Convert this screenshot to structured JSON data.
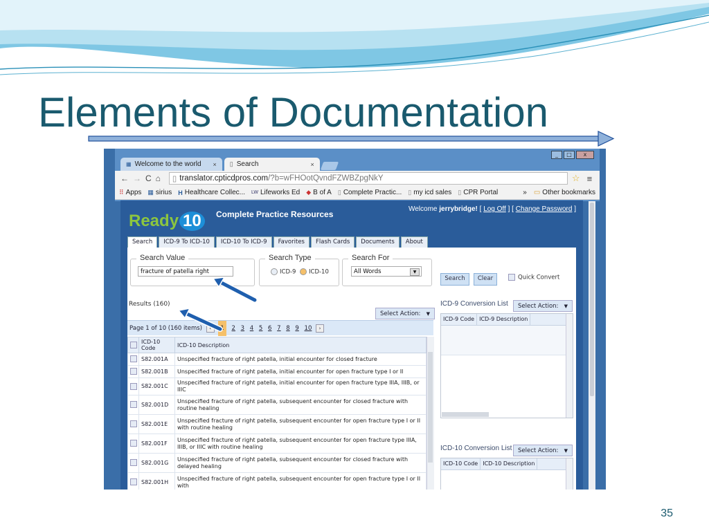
{
  "slide": {
    "title": "Elements of Documentation",
    "page_number": "35"
  },
  "browser": {
    "tabs": [
      {
        "label": "Welcome to the world",
        "close": "×"
      },
      {
        "label": "Search",
        "close": "×"
      }
    ],
    "window_buttons": [
      "_",
      "□",
      "x"
    ],
    "url_host": "translator.cpticdpros.com",
    "url_rest": "/?b=wFHOotQvndFZWBZpgNkY",
    "bookmarks": [
      "Apps",
      "sirius",
      "Healthcare Collec...",
      "Lifeworks Ed",
      "B of A",
      "Complete Practic...",
      "my icd sales",
      "CPR Portal"
    ],
    "bookmark_icons": [
      "H",
      "LW"
    ],
    "more": "»",
    "other_bookmarks": "Other bookmarks"
  },
  "app": {
    "logo_text": "Ready",
    "logo_badge": "10",
    "subtitle": "Complete Practice Resources",
    "welcome_prefix": "Welcome",
    "username": "jerrybridge!",
    "log_off": "Log Off",
    "change_password": "Change Password",
    "tabs": [
      "Search",
      "ICD-9 To ICD-10",
      "ICD-10 To ICD-9",
      "Favorites",
      "Flash Cards",
      "Documents",
      "About"
    ],
    "search_value_legend": "Search Value",
    "search_value": "fracture of patella right",
    "search_type_legend": "Search Type",
    "search_types": [
      "ICD-9",
      "ICD-10"
    ],
    "search_type_selected": "ICD-10",
    "search_for_legend": "Search For",
    "search_for_value": "All Words",
    "search_button": "Search",
    "clear_button": "Clear",
    "quick_convert": "Quick Convert",
    "results_label": "Results (160)",
    "select_action": "Select Action:",
    "pager_text": "Page 1 of 10 (160 items)",
    "pages": [
      "1",
      "2",
      "3",
      "4",
      "5",
      "6",
      "7",
      "8",
      "9",
      "10"
    ],
    "current_page": "1",
    "grid_headers": [
      "ICD-10 Code",
      "ICD-10 Description"
    ],
    "rows": [
      {
        "code": "S82.001A",
        "desc": "Unspecified fracture of right patella, initial encounter for closed fracture"
      },
      {
        "code": "S82.001B",
        "desc": "Unspecified fracture of right patella, initial encounter for open fracture type I or II"
      },
      {
        "code": "S82.001C",
        "desc": "Unspecified fracture of right patella, initial encounter for open fracture type IIIA, IIIB, or IIIC"
      },
      {
        "code": "S82.001D",
        "desc": "Unspecified fracture of right patella, subsequent encounter for closed fracture with routine healing"
      },
      {
        "code": "S82.001E",
        "desc": "Unspecified fracture of right patella, subsequent encounter for open fracture type I or II with routine healing"
      },
      {
        "code": "S82.001F",
        "desc": "Unspecified fracture of right patella, subsequent encounter for open fracture type IIIA, IIIB, or IIIC with routine healing"
      },
      {
        "code": "S82.001G",
        "desc": "Unspecified fracture of right patella, subsequent encounter for closed fracture with delayed healing"
      },
      {
        "code": "S82.001H",
        "desc": "Unspecified fracture of right patella, subsequent encounter for open fracture type I or II with"
      }
    ],
    "icd9_conv_title": "ICD-9 Conversion List",
    "icd9_headers": [
      "ICD-9 Code",
      "ICD-9 Description"
    ],
    "icd10_conv_title": "ICD-10 Conversion List",
    "icd10_headers": [
      "ICD-10 Code",
      "ICD-10 Description"
    ]
  },
  "colors": {
    "title": "#1a5a6e",
    "app_blue": "#2a5c9a",
    "accent_orange": "#f5c06a",
    "annotation_arrow": "#1f5fae"
  }
}
